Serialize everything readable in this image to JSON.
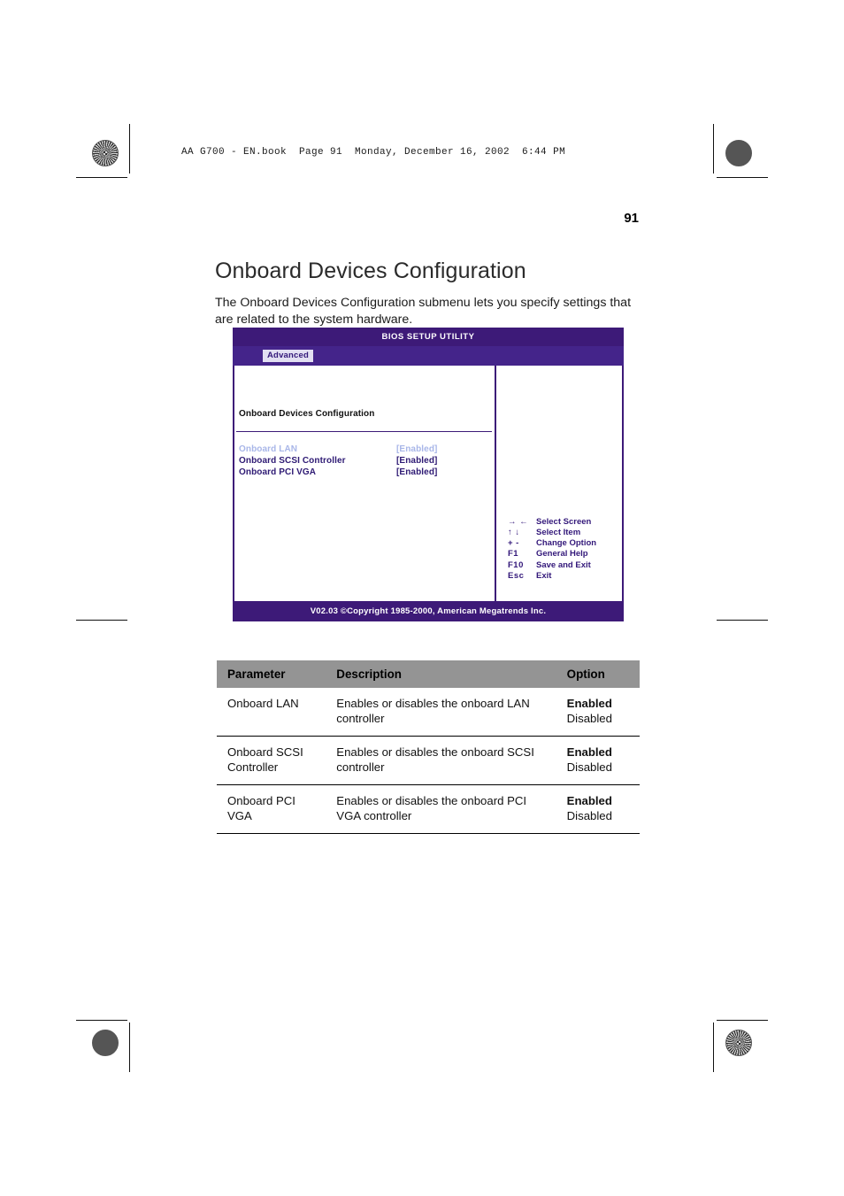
{
  "book_header": "AA G700 - EN.book  Page 91  Monday, December 16, 2002  6:44 PM",
  "page_number": "91",
  "page_title": "Onboard Devices Configuration",
  "intro_text": "The Onboard Devices Configuration submenu lets you specify settings that are related to the system hardware.",
  "bios": {
    "title": "BIOS SETUP UTILITY",
    "active_tab": "Advanced",
    "submenu_title": "Onboard Devices Configuration",
    "settings": [
      {
        "name": "Onboard LAN",
        "value": "[Enabled]",
        "state": "highlight"
      },
      {
        "name": "Onboard SCSI Controller",
        "value": "[Enabled]",
        "state": "normal"
      },
      {
        "name": "Onboard PCI VGA",
        "value": "[Enabled]",
        "state": "normal"
      }
    ],
    "keys": [
      {
        "combo": "→ ←",
        "label": "Select Screen"
      },
      {
        "combo": "↑ ↓",
        "label": "Select Item"
      },
      {
        "combo": "+ -",
        "label": "Change Option"
      },
      {
        "combo": "F1",
        "label": "General Help"
      },
      {
        "combo": "F10",
        "label": "Save and Exit"
      },
      {
        "combo": "Esc",
        "label": "Exit"
      }
    ],
    "footer": "V02.03 ©Copyright 1985-2000, American Megatrends Inc.",
    "colors": {
      "title_bar": "#3d1a78",
      "menu_bar": "#44248a",
      "tab_bg": "#e2dff2",
      "tab_text": "#33187a",
      "setting_normal": "#2e1a74",
      "setting_highlight": "#a8b6e8"
    }
  },
  "table": {
    "headers": [
      "Parameter",
      "Description",
      "Option"
    ],
    "header_bg": "#949494",
    "rows": [
      {
        "parameter": "Onboard LAN",
        "description": "Enables or disables the onboard LAN controller",
        "option_primary": "Enabled",
        "option_secondary": "Disabled"
      },
      {
        "parameter": "Onboard SCSI Controller",
        "description": "Enables or disables the onboard SCSI controller",
        "option_primary": "Enabled",
        "option_secondary": "Disabled"
      },
      {
        "parameter": "Onboard PCI VGA",
        "description": "Enables or disables the onboard PCI VGA controller",
        "option_primary": "Enabled",
        "option_secondary": "Disabled"
      }
    ]
  }
}
